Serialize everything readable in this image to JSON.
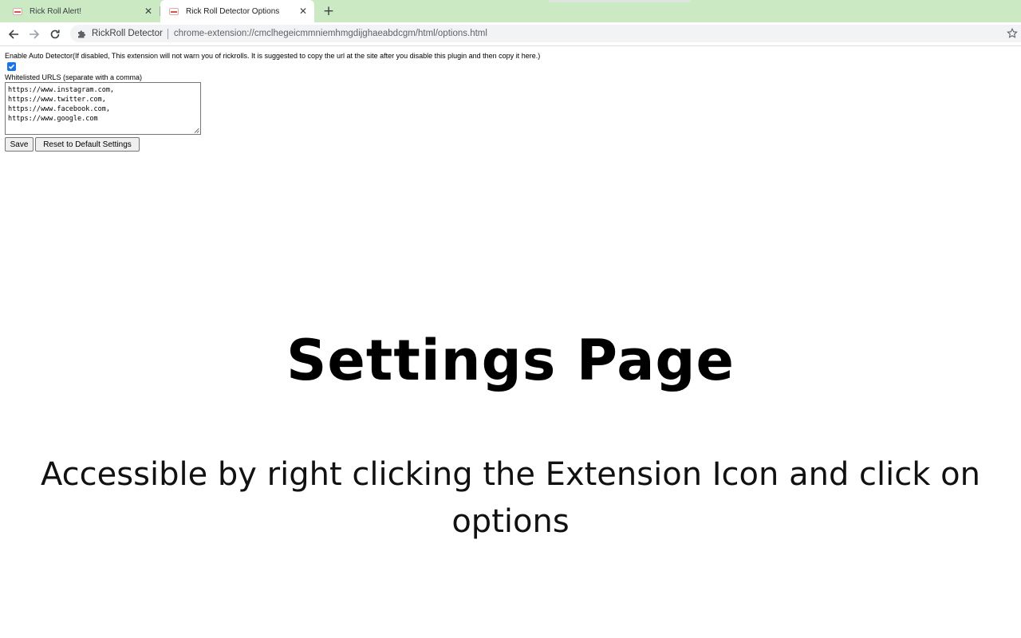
{
  "browser": {
    "tabs": [
      {
        "title": "Rick Roll Alert!",
        "close": "✕"
      },
      {
        "title": "Rick Roll Detector Options",
        "close": "✕"
      }
    ],
    "new_tab": "+",
    "omnibox": {
      "site_name": "RickRoll Detector",
      "url": "chrome-extension://cmclhegeicmmniemhmgdijghaeabdcgm/html/options.html"
    }
  },
  "settings": {
    "auto_detector_label": "Enable Auto Detector(If disabled, This extension will not warn you of rickrolls. It is suggested to copy the url at the site after you disable this plugin and then copy it here.)",
    "auto_detector_checked": true,
    "whitelist_label": "Whitelisted URLS (separate with a comma)",
    "whitelist_value": "https://www.instagram.com,\nhttps://www.twitter.com,\nhttps://www.facebook.com,\nhttps://www.google.com",
    "save_label": "Save",
    "reset_label": "Reset to Default Settings"
  },
  "main": {
    "title": "Settings Page",
    "subtitle": "Accessible by right clicking the Extension Icon and click on options"
  },
  "colors": {
    "tabstrip": "#cbe9c3",
    "checkbox": "#1a73e8"
  }
}
